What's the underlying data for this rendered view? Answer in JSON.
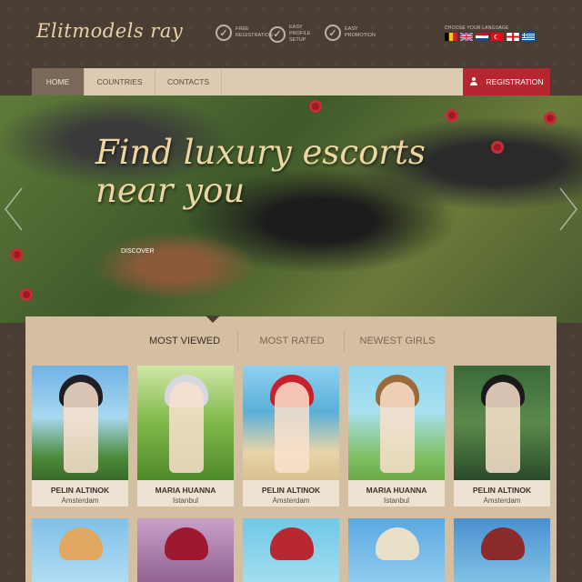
{
  "header": {
    "logo": "Elitmodels ray",
    "features": [
      {
        "line1": "FREE",
        "line2": "REGISTRATION"
      },
      {
        "line1": "EASY",
        "line2": "PROFILE SETUP"
      },
      {
        "line1": "EASY",
        "line2": "PROMOTION"
      }
    ],
    "language_label": "CHOOSE YOUR LANGUAGE"
  },
  "nav": {
    "items": [
      "HOME",
      "COUNTRIES",
      "CONTACTS"
    ],
    "registration": "REGISTRATION"
  },
  "hero": {
    "title": "Find luxury escorts near you",
    "discover": "DISCOVER"
  },
  "tabs": [
    "MOST VIEWED",
    "MOST RATED",
    "NEWEST GIRLS"
  ],
  "profiles": [
    {
      "name": "PELIN ALTINOK",
      "city": "Amsterdam"
    },
    {
      "name": "MARIA HUANNA",
      "city": "Istanbul"
    },
    {
      "name": "PELIN ALTINOK",
      "city": "Amsterdam"
    },
    {
      "name": "MARIA HUANNA",
      "city": "Istanbul"
    },
    {
      "name": "PELIN ALTINOK",
      "city": "Amsterdam"
    }
  ],
  "colors": {
    "background": "#4a3d33",
    "nav": "#ddcab3",
    "nav_active": "#7a6858",
    "registration": "#b62630",
    "panel": "#d5bfa2",
    "logo": "#e8d3a6"
  }
}
